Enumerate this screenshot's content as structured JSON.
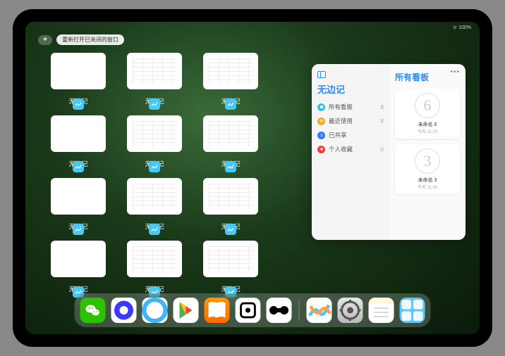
{
  "status": {
    "battery": "100%"
  },
  "top": {
    "add": "+",
    "reopen_label": "重新打开已关闭的窗口"
  },
  "app_name": "无边记",
  "thumbs": [
    [
      {
        "label": "无边记",
        "variant": "blank"
      },
      {
        "label": "无边记",
        "variant": "content"
      },
      {
        "label": "无边记",
        "variant": "content"
      }
    ],
    [
      {
        "label": "无边记",
        "variant": "blank"
      },
      {
        "label": "无边记",
        "variant": "content"
      },
      {
        "label": "无边记",
        "variant": "content"
      }
    ],
    [
      {
        "label": "无边记",
        "variant": "blank"
      },
      {
        "label": "无边记",
        "variant": "content"
      },
      {
        "label": "无边记",
        "variant": "content"
      }
    ],
    [
      {
        "label": "无边记",
        "variant": "blank"
      },
      {
        "label": "无边记",
        "variant": "content"
      },
      {
        "label": "无边记",
        "variant": "content"
      }
    ]
  ],
  "panel": {
    "left_title": "无边记",
    "right_title": "所有看板",
    "items": [
      {
        "label": "所有看板",
        "count": "8",
        "color": "#34c5e0"
      },
      {
        "label": "最近使用",
        "count": "8",
        "color": "#f5a623"
      },
      {
        "label": "已共享",
        "count": "",
        "color": "#3478f6"
      },
      {
        "label": "个人收藏",
        "count": "0",
        "color": "#ff3b30"
      }
    ],
    "boards": [
      {
        "sketch": "6",
        "title": "未命名 6",
        "sub": "今天 11:25"
      },
      {
        "sketch": "3",
        "title": "未命名 3",
        "sub": "今天 11:25"
      }
    ]
  },
  "dock": {
    "left": [
      "wechat",
      "quark",
      "browser",
      "play",
      "books",
      "dice",
      "barbell"
    ],
    "right": [
      "freeform",
      "settings",
      "notes",
      "folder"
    ]
  }
}
